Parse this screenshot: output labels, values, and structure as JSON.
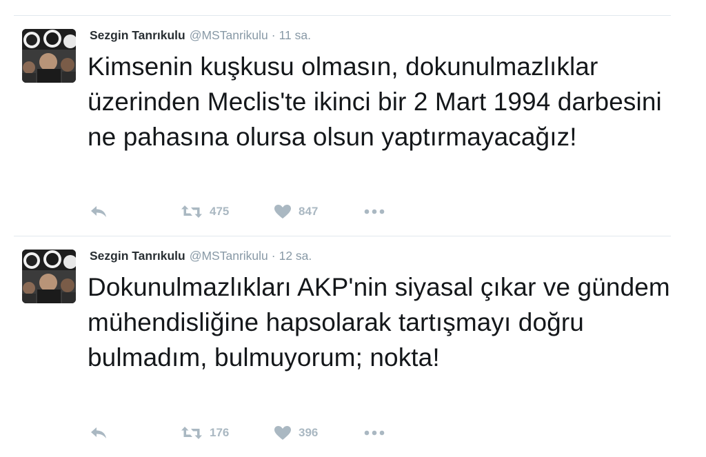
{
  "colors": {
    "name": "#292f33",
    "meta": "#8899a6",
    "text": "#14171a",
    "action_icon": "#aab8c2",
    "divider": "#e1e8ed"
  },
  "tweets": [
    {
      "author_name": "Sezgin Tanrıkulu",
      "handle": "@MSTanrikulu",
      "separator": "·",
      "time": "11 sa.",
      "text": "Kimsenin kuşkusu olmasın, dokunulmazlıklar üzerinden Meclis'te ikinci bir 2 Mart 1994 darbesini ne pahasına olursa olsun yaptırmayacağız!",
      "retweets": "475",
      "likes": "847",
      "icons": [
        "reply-icon",
        "retweet-icon",
        "heart-icon",
        "more-icon"
      ]
    },
    {
      "author_name": "Sezgin Tanrıkulu",
      "handle": "@MSTanrikulu",
      "separator": "·",
      "time": "12 sa.",
      "text": "Dokunulmazlıkları AKP'nin siyasal çıkar ve gündem mühendisliğine hapsolarak tartışmayı doğru bulmadım, bulmuyorum; nokta!",
      "retweets": "176",
      "likes": "396",
      "icons": [
        "reply-icon",
        "retweet-icon",
        "heart-icon",
        "more-icon"
      ]
    }
  ]
}
